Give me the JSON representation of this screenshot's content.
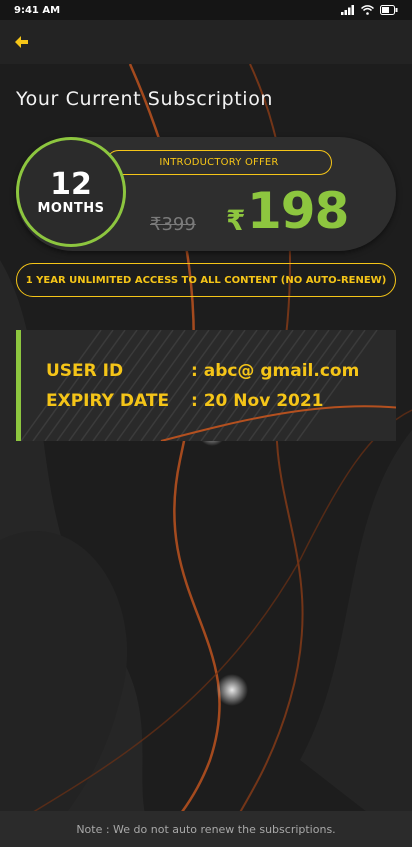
{
  "status_bar": {
    "time": "9:41 AM"
  },
  "header": {
    "back_icon": "arrow-left-icon"
  },
  "page": {
    "title": "Your Current Subscription"
  },
  "plan": {
    "months_number": "12",
    "months_label": "MONTHS",
    "offer_label": "INTRODUCTORY OFFER",
    "old_price": "₹399",
    "currency_symbol": "₹",
    "new_price": "198",
    "access_text": "1 YEAR UNLIMITED ACCESS TO ALL CONTENT (NO AUTO-RENEW)"
  },
  "account": {
    "user_id_label": "USER ID",
    "user_id_value": ": abc@ gmail.com",
    "expiry_label": "EXPIRY DATE",
    "expiry_value": ": 20 Nov 2021"
  },
  "footer": {
    "note": "Note : We do not auto renew the subscriptions."
  },
  "colors": {
    "accent_green": "#8dc63f",
    "accent_yellow": "#f5c518",
    "background": "#1d1d1d"
  }
}
